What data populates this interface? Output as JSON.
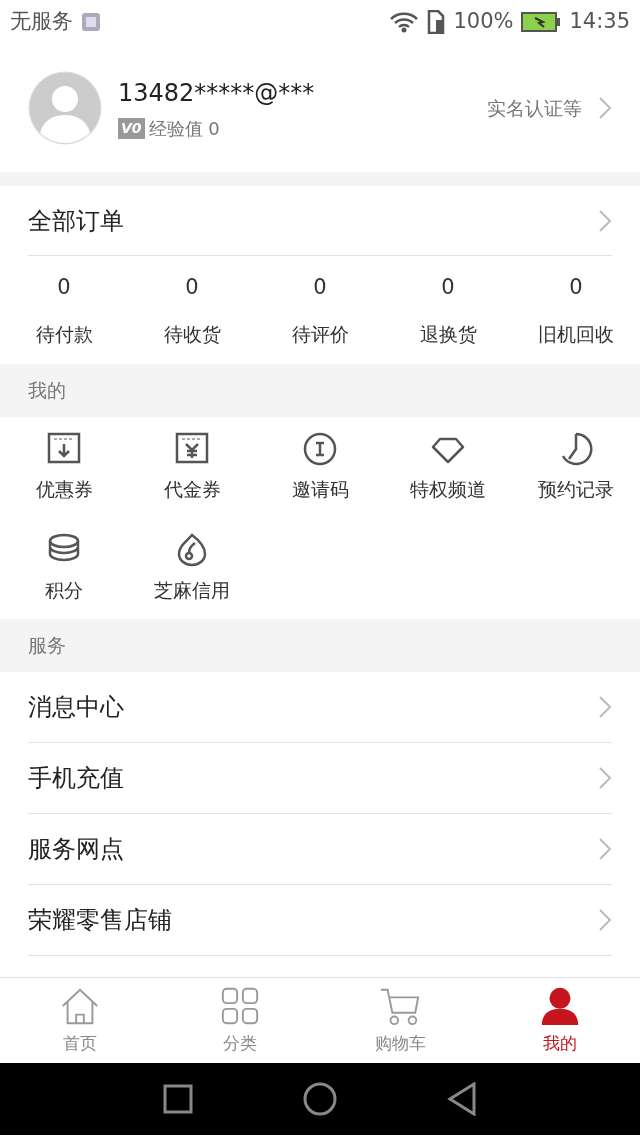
{
  "status_bar": {
    "carrier": "无服务",
    "battery": "100%",
    "time": "14:35"
  },
  "profile": {
    "account": "13482*****@***",
    "level_badge": "V0",
    "experience": "经验值 0",
    "verify_link": "实名认证等"
  },
  "orders": {
    "title": "全部订单",
    "stats": [
      {
        "count": "0",
        "label": "待付款"
      },
      {
        "count": "0",
        "label": "待收货"
      },
      {
        "count": "0",
        "label": "待评价"
      },
      {
        "count": "0",
        "label": "退换货"
      },
      {
        "count": "0",
        "label": "旧机回收"
      }
    ]
  },
  "mine": {
    "header": "我的",
    "items": [
      {
        "label": "优惠券"
      },
      {
        "label": "代金券"
      },
      {
        "label": "邀请码"
      },
      {
        "label": "特权频道"
      },
      {
        "label": "预约记录"
      },
      {
        "label": "积分"
      },
      {
        "label": "芝麻信用"
      }
    ]
  },
  "services": {
    "header": "服务",
    "items": [
      {
        "label": "消息中心"
      },
      {
        "label": "手机充值"
      },
      {
        "label": "服务网点"
      },
      {
        "label": "荣耀零售店铺"
      }
    ]
  },
  "tab_bar": [
    {
      "label": "首页",
      "selected": false
    },
    {
      "label": "分类",
      "selected": false
    },
    {
      "label": "购物车",
      "selected": false
    },
    {
      "label": "我的",
      "selected": true
    }
  ]
}
